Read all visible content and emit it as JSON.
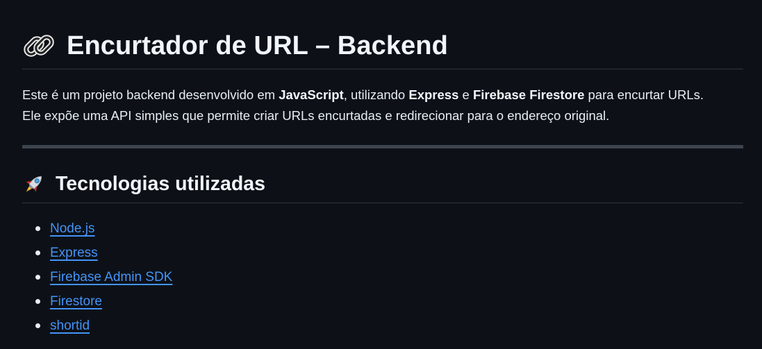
{
  "heading": {
    "icon": "link-icon",
    "title": "Encurtador de URL – Backend"
  },
  "intro": {
    "line1": {
      "part1": "Este é um projeto backend desenvolvido em ",
      "bold1": "JavaScript",
      "part2": ", utilizando ",
      "bold2": "Express",
      "part3": " e ",
      "bold3": "Firebase Firestore",
      "part4": " para encurtar URLs."
    },
    "line2": "Ele expõe uma API simples que permite criar URLs encurtadas e redirecionar para o endereço original."
  },
  "tech_section": {
    "icon": "rocket-icon",
    "title": "Tecnologias utilizadas",
    "items": [
      {
        "label": "Node.js"
      },
      {
        "label": "Express"
      },
      {
        "label": "Firebase Admin SDK"
      },
      {
        "label": "Firestore"
      },
      {
        "label": "shortid"
      }
    ]
  },
  "colors": {
    "background": "#0d1117",
    "text": "#e6edf3",
    "link": "#4493f8",
    "divider": "#30363d"
  }
}
